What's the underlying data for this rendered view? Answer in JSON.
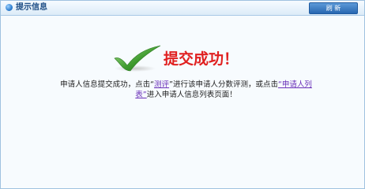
{
  "window": {
    "title": "提示信息",
    "refresh_label": "刷 新"
  },
  "icons": {
    "title_icon": "blue-dot-icon",
    "success_icon": "checkmark-icon"
  },
  "result": {
    "title": "提交成功！",
    "msg_part1": "申请人信息提交成功，点击",
    "quote_open1": "“",
    "link_eval": "测评",
    "quote_close1": "”",
    "msg_part2": "进行该申请人分数评测，或点击",
    "link_list_a": "“申请人列",
    "link_list_b": "表”",
    "msg_part3": "进入申请人信息列表页面！"
  },
  "colors": {
    "title_red": "#e02020",
    "link_purple": "#6a30b8",
    "header_blue": "#1f4f86"
  }
}
